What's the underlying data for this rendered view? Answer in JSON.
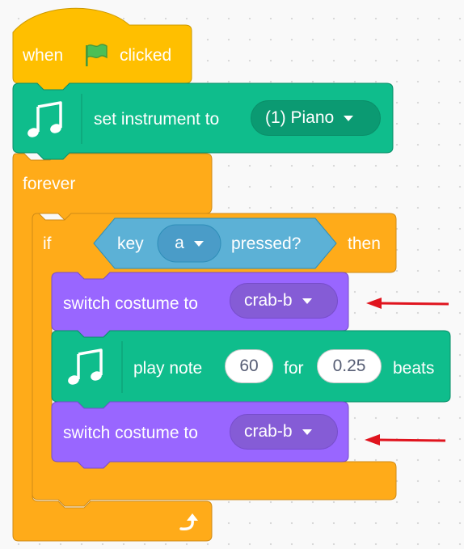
{
  "hat": {
    "prefix": "when",
    "suffix": "clicked",
    "icon": "green-flag-icon"
  },
  "set_instrument": {
    "label": "set instrument to",
    "value": "(1) Piano",
    "icon": "music-notes-icon"
  },
  "forever": {
    "label": "forever",
    "icon": "loop-arrow-icon"
  },
  "if_block": {
    "if_label": "if",
    "then_label": "then",
    "condition": {
      "label_before": "key",
      "key_value": "a",
      "label_after": "pressed?"
    }
  },
  "switch_costume_1": {
    "label": "switch costume to",
    "value": "crab-b"
  },
  "play_note": {
    "label": "play note",
    "note": "60",
    "for_label": "for",
    "beats": "0.25",
    "beats_label": "beats",
    "icon": "music-notes-icon"
  },
  "switch_costume_2": {
    "label": "switch costume to",
    "value": "crab-b"
  },
  "colors": {
    "events": "#FFBF00",
    "events_border": "#CC9900",
    "control": "#FFAB19",
    "control_border": "#CF8B17",
    "music": "#0FBD8C",
    "music_border": "#0B8E69",
    "looks": "#9966FF",
    "looks_border": "#774DCB",
    "sensing": "#5CB1D6",
    "sensing_border": "#2E8EB8",
    "arrow": "#E0141E"
  }
}
